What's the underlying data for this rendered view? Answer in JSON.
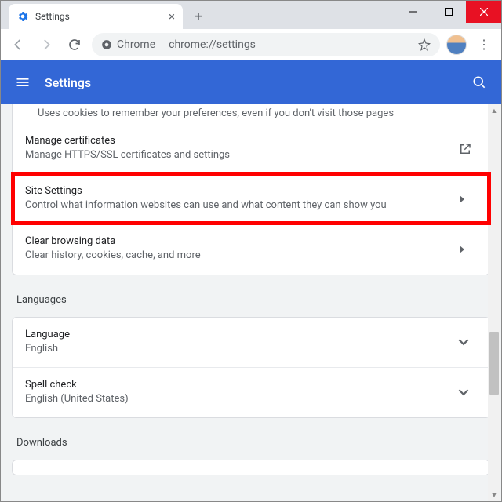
{
  "window": {
    "tab_title": "Settings"
  },
  "omnibox": {
    "scheme_label": "Chrome",
    "url": "chrome://settings"
  },
  "header": {
    "title": "Settings"
  },
  "privacy": {
    "peek": "Uses cookies to remember your preferences, even if you don't visit those pages",
    "certs_label": "Manage certificates",
    "certs_sub": "Manage HTTPS/SSL certificates and settings",
    "site_label": "Site Settings",
    "site_sub": "Control what information websites can use and what content they can show you",
    "clear_label": "Clear browsing data",
    "clear_sub": "Clear history, cookies, cache, and more"
  },
  "languages": {
    "section": "Languages",
    "lang_label": "Language",
    "lang_sub": "English",
    "spell_label": "Spell check",
    "spell_sub": "English (United States)"
  },
  "downloads": {
    "section": "Downloads"
  }
}
